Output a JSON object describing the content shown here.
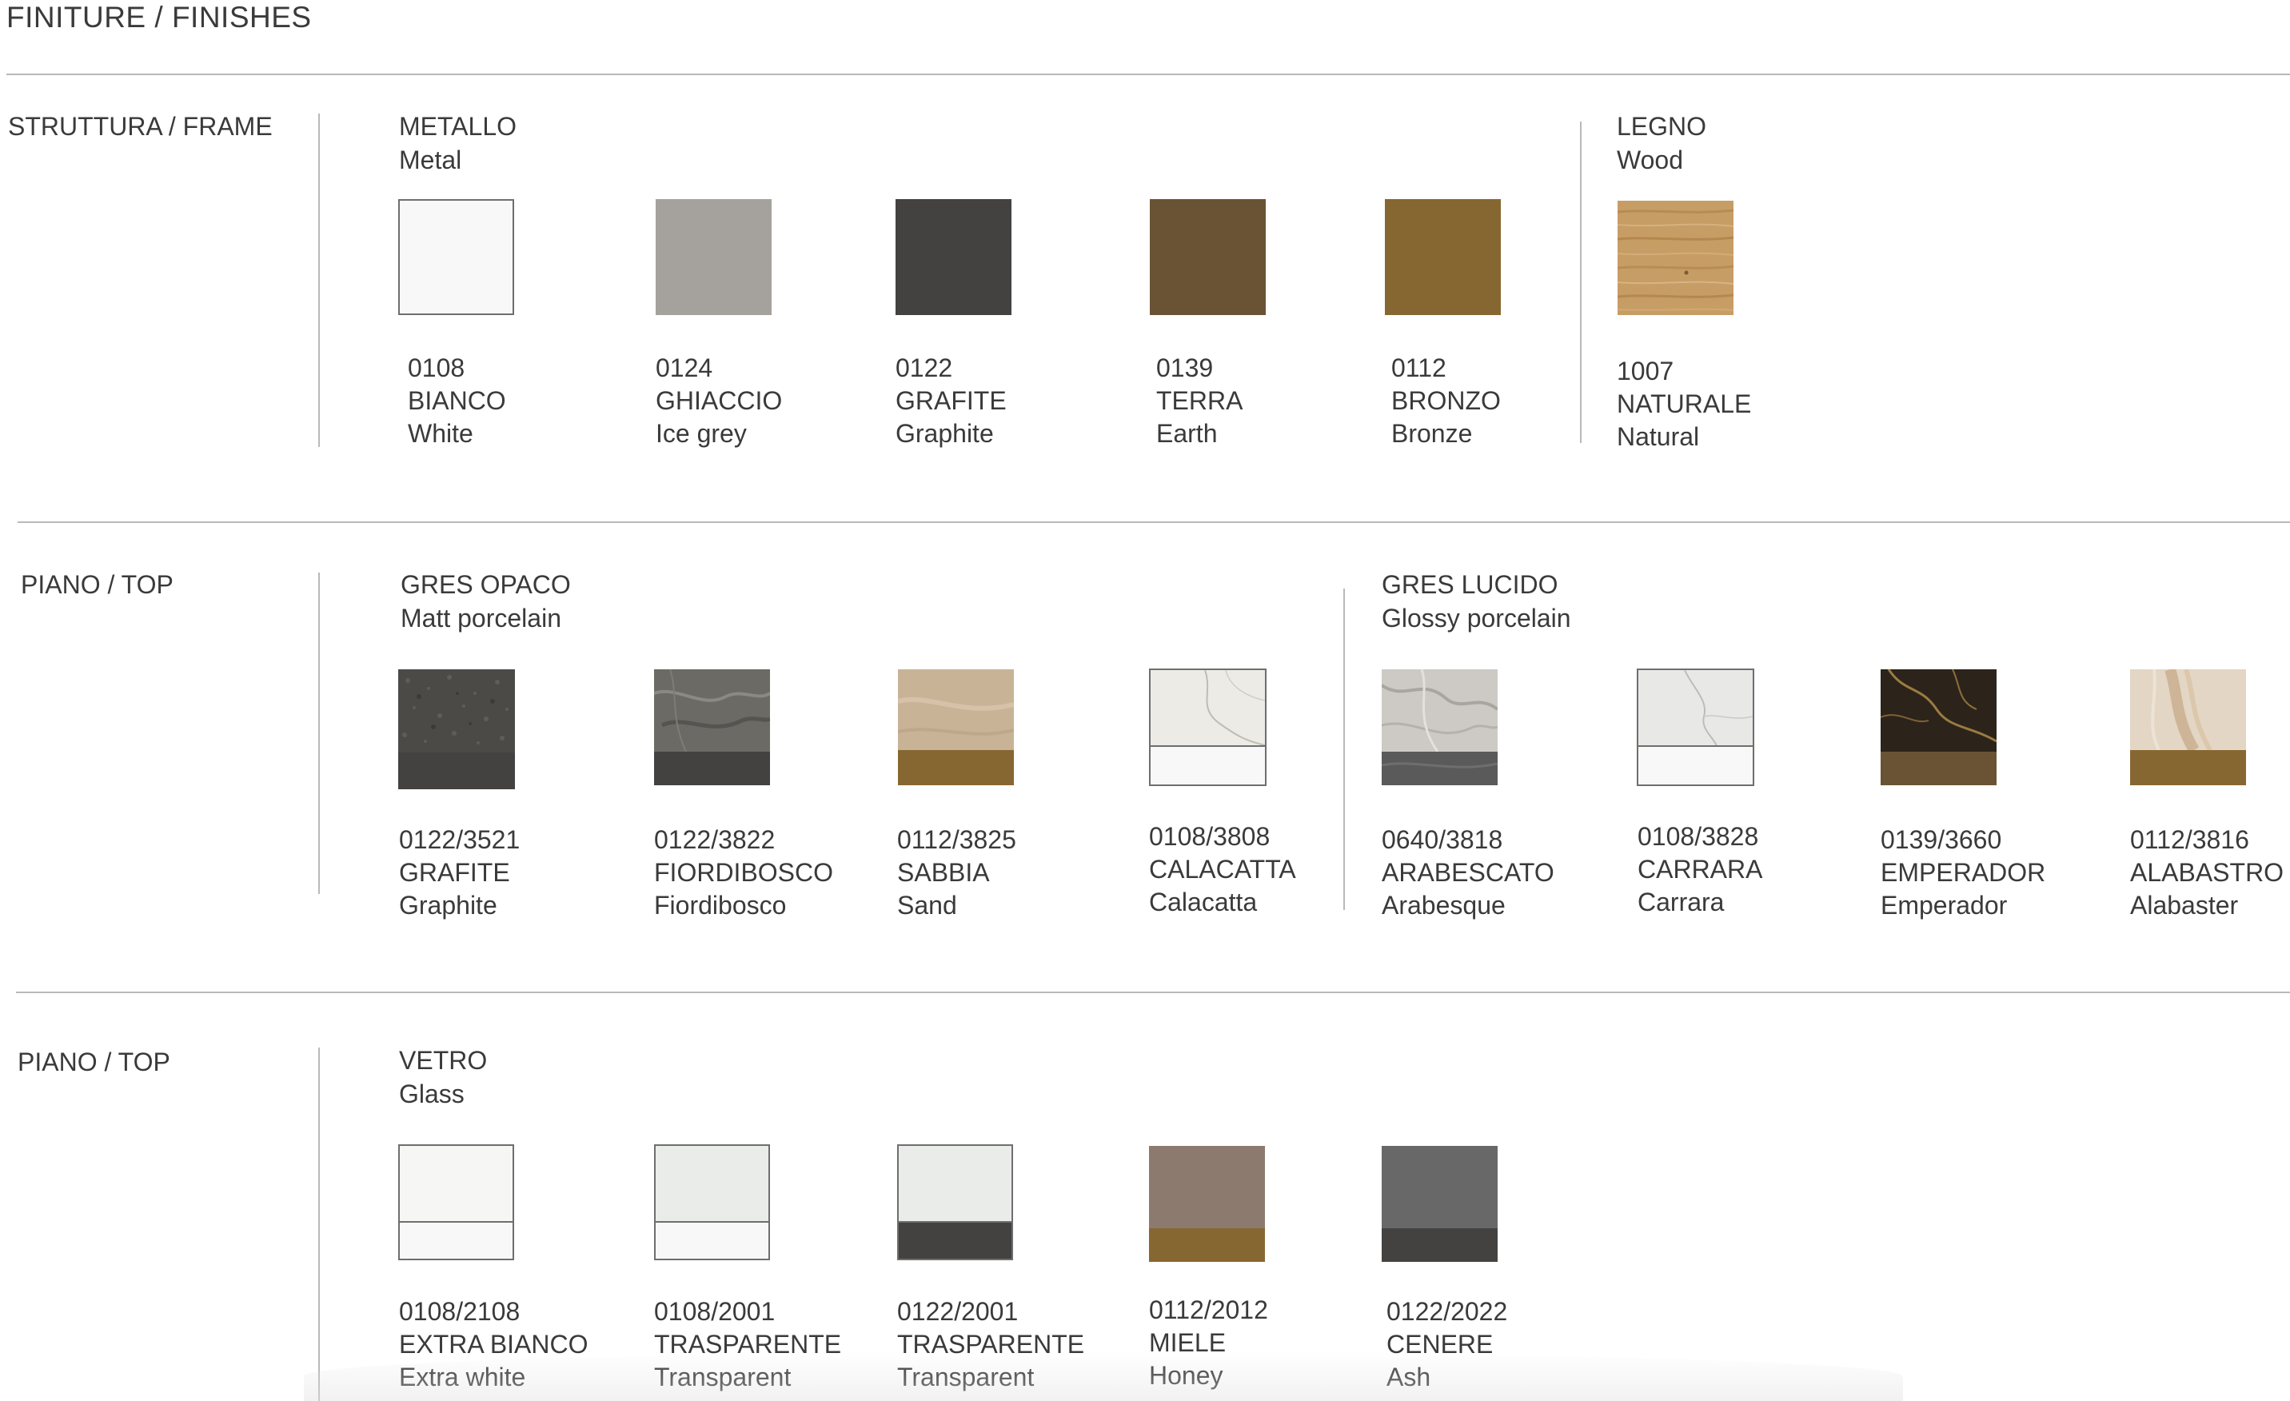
{
  "title": "FINITURE / FINISHES",
  "frame": {
    "label": "STRUTTURA / FRAME",
    "metal": {
      "title_it": "METALLO",
      "title_en": "Metal",
      "swatches": [
        {
          "code": "0108",
          "name_it": "BIANCO",
          "name_en": "White",
          "color": "#f8f8f8"
        },
        {
          "code": "0124",
          "name_it": "GHIACCIO",
          "name_en": "Ice grey",
          "color": "#a5a19d"
        },
        {
          "code": "0122",
          "name_it": "GRAFITE",
          "name_en": "Graphite",
          "color": "#434240"
        },
        {
          "code": "0139",
          "name_it": "TERRA",
          "name_en": "Earth",
          "color": "#6a5334"
        },
        {
          "code": "0112",
          "name_it": "BRONZO",
          "name_en": "Bronze",
          "color": "#876731"
        }
      ]
    },
    "wood": {
      "title_it": "LEGNO",
      "title_en": "Wood",
      "swatches": [
        {
          "code": "1007",
          "name_it": "NATURALE",
          "name_en": "Natural",
          "color": "#c79d66"
        }
      ]
    }
  },
  "top1": {
    "label": "PIANO / TOP",
    "matt": {
      "title_it": "GRES OPACO",
      "title_en": "Matt porcelain",
      "swatches": [
        {
          "code": "0122/3521",
          "name_it": "GRAFITE",
          "name_en": "Graphite",
          "top_color": "#4b4a47",
          "bottom_color": "#434240"
        },
        {
          "code": "0122/3822",
          "name_it": "FIORDIBOSCO",
          "name_en": "Fiordibosco",
          "top_color": "#6b6a64",
          "bottom_color": "#434240"
        },
        {
          "code": "0112/3825",
          "name_it": "SABBIA",
          "name_en": "Sand",
          "top_color": "#c9b397",
          "bottom_color": "#876731"
        },
        {
          "code": "0108/3808",
          "name_it": "CALACATTA",
          "name_en": "Calacatta",
          "top_color": "#ecebe6",
          "bottom_color": "#f8f8f8"
        }
      ]
    },
    "glossy": {
      "title_it": "GRES LUCIDO",
      "title_en": "Glossy porcelain",
      "swatches": [
        {
          "code": "0640/3818",
          "name_it": "ARABESCATO",
          "name_en": "Arabesque",
          "top_color": "#cdcac5",
          "bottom_color": "#5a5a5a"
        },
        {
          "code": "0108/3828",
          "name_it": "CARRARA",
          "name_en": "Carrara",
          "top_color": "#e8e8e6",
          "bottom_color": "#f8f8f8"
        },
        {
          "code": "0139/3660",
          "name_it": "EMPERADOR",
          "name_en": "Emperador",
          "top_color": "#2c241a",
          "bottom_color": "#6a5334"
        },
        {
          "code": "0112/3816",
          "name_it": "ALABASTRO",
          "name_en": "Alabaster",
          "top_color": "#e3d6c4",
          "bottom_color": "#876731"
        }
      ]
    }
  },
  "top2": {
    "label": "PIANO / TOP",
    "glass": {
      "title_it": "VETRO",
      "title_en": "Glass",
      "swatches": [
        {
          "code": "0108/2108",
          "name_it": "EXTRA BIANCO",
          "name_en": "Extra white",
          "top_color": "#f6f6f5",
          "bottom_color": "#f8f8f8"
        },
        {
          "code": "0108/2001",
          "name_it": "TRASPARENTE",
          "name_en": "Transparent",
          "top_color": "#e9ece9",
          "bottom_color": "#f8f8f8"
        },
        {
          "code": "0122/2001",
          "name_it": "TRASPARENTE",
          "name_en": "Transparent",
          "top_color": "#e9ece9",
          "bottom_color": "#434240"
        },
        {
          "code": "0112/2012",
          "name_it": "MIELE",
          "name_en": "Honey",
          "top_color": "#8c7a6f",
          "bottom_color": "#876731"
        },
        {
          "code": "0122/2022",
          "name_it": "CENERE",
          "name_en": "Ash",
          "top_color": "#686868",
          "bottom_color": "#434240"
        }
      ]
    }
  }
}
